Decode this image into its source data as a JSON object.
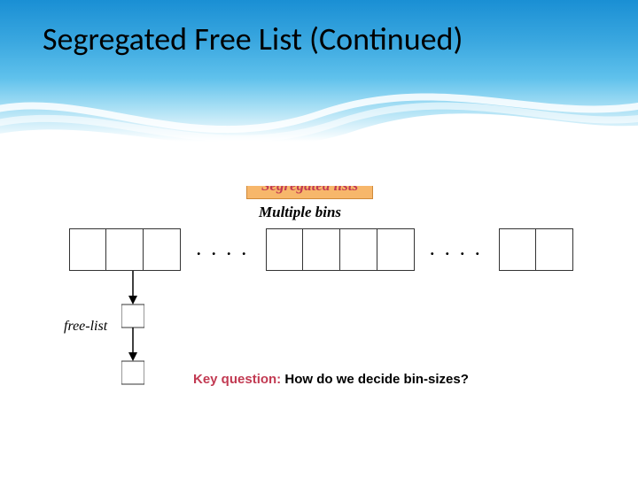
{
  "slide": {
    "title": "Segregated Free List (Continued)",
    "section_label": "Segregated lists",
    "subtitle": "Multiple bins",
    "ellipsis": ". . . .",
    "free_list_label": "free-list",
    "key_question_label": "Key question: ",
    "key_question_text": "How do we decide bin-sizes?"
  }
}
